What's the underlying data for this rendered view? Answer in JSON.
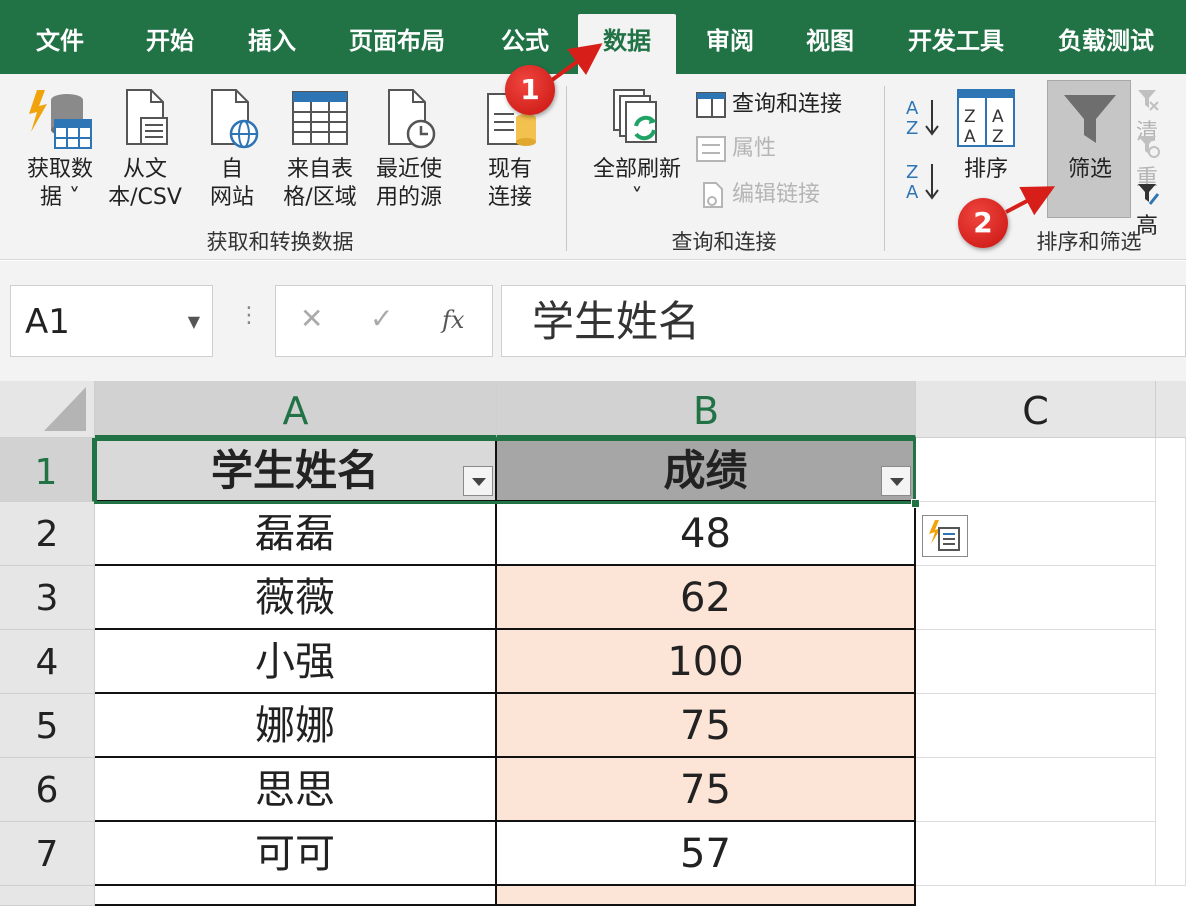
{
  "tabs": [
    "文件",
    "开始",
    "插入",
    "页面布局",
    "公式",
    "数据",
    "审阅",
    "视图",
    "开发工具",
    "负载测试"
  ],
  "active_tab": "数据",
  "ribbon": {
    "get_transform": {
      "get_data": "获取数\n据 ˅",
      "from_text": "从文\n本/CSV",
      "from_web": "自\n网站",
      "from_table": "来自表\n格/区域",
      "recent_sources": "最近使\n用的源",
      "existing_conn": "现有\n连接",
      "group_label": "获取和转换数据"
    },
    "queries": {
      "refresh_all": "全部刷新",
      "refresh_arrow": "˅",
      "queries_conn": "查询和连接",
      "properties": "属性",
      "edit_links": "编辑链接",
      "group_label": "查询和连接"
    },
    "sort_filter": {
      "sort": "排序",
      "filter": "筛选",
      "clear": "清",
      "reapply": "重",
      "advanced": "高",
      "group_label": "排序和筛选"
    }
  },
  "formula_bar": {
    "name_box": "A1",
    "formula": "学生姓名"
  },
  "columns": [
    "A",
    "B",
    "C"
  ],
  "rows": [
    {
      "num": "1",
      "a": "学生姓名",
      "b": "成绩"
    },
    {
      "num": "2",
      "a": "磊磊",
      "b": "48"
    },
    {
      "num": "3",
      "a": "薇薇",
      "b": "62"
    },
    {
      "num": "4",
      "a": "小强",
      "b": "100"
    },
    {
      "num": "5",
      "a": "娜娜",
      "b": "75"
    },
    {
      "num": "6",
      "a": "思思",
      "b": "75"
    },
    {
      "num": "7",
      "a": "可可",
      "b": "57"
    }
  ],
  "annotations": [
    "1",
    "2"
  ],
  "colors": {
    "excel_green": "#217346",
    "highlight_pink": "#fce4d6",
    "header_gray": "#d9d9d9",
    "badge_red": "#d81e18"
  }
}
